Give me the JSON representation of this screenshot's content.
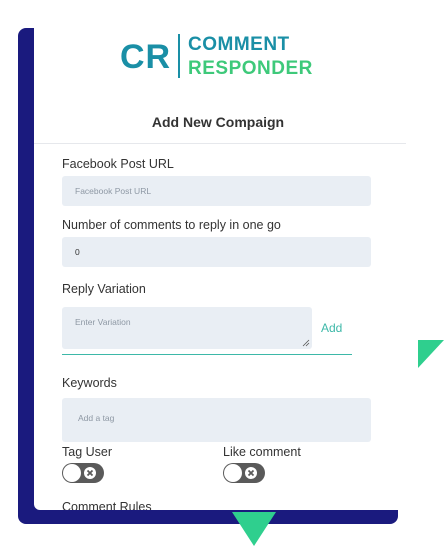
{
  "logo": {
    "short": "CR",
    "line1": "COMMENT",
    "line2": "RESPONDER"
  },
  "form": {
    "title": "Add New Compaign",
    "post_url": {
      "label": "Facebook Post URL",
      "placeholder": "Facebook Post URL"
    },
    "comments_count": {
      "label": "Number of comments to reply in one go",
      "value": "0"
    },
    "reply_variation": {
      "label": "Reply Variation",
      "placeholder": "Enter Variation",
      "add_label": "Add"
    },
    "keywords": {
      "label": "Keywords",
      "placeholder": "Add a tag"
    },
    "tag_user": {
      "label": "Tag User",
      "enabled": false
    },
    "like_comment": {
      "label": "Like comment",
      "enabled": false
    },
    "next_section_label": "Comment Rules"
  },
  "colors": {
    "brand_blue": "#1a8fa6",
    "brand_green": "#3ec97a",
    "accent_teal": "#3db8a8",
    "backdrop_navy": "#1a1a7e",
    "decor_green": "#2fcf8e"
  }
}
